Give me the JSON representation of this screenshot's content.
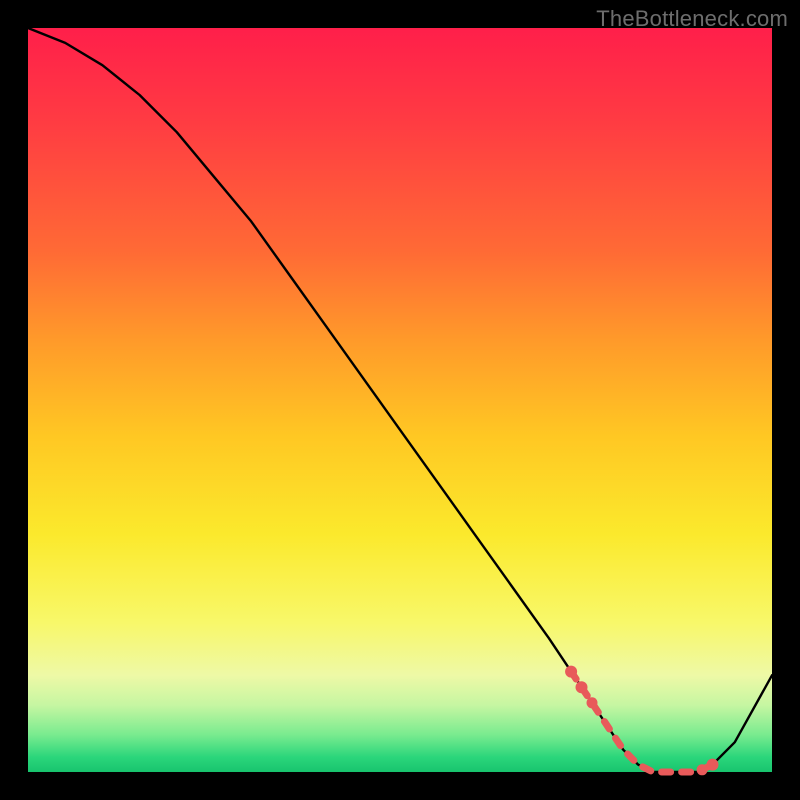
{
  "watermark": "TheBottleneck.com",
  "colors": {
    "background": "#000000",
    "curve": "#000000",
    "highlight": "#e85a5a",
    "gradient_top": "#ff1f4a",
    "gradient_mid": "#fbe92c",
    "gradient_bottom": "#18c46e"
  },
  "chart_data": {
    "type": "line",
    "title": "",
    "xlabel": "",
    "ylabel": "",
    "xlim": [
      0,
      100
    ],
    "ylim": [
      0,
      100
    ],
    "grid": false,
    "legend": false,
    "series": [
      {
        "name": "bottleneck-curve",
        "x": [
          0,
          5,
          10,
          15,
          20,
          25,
          30,
          35,
          40,
          45,
          50,
          55,
          60,
          65,
          70,
          74,
          76,
          78,
          80,
          82,
          84,
          86,
          88,
          90,
          92,
          95,
          100
        ],
        "y": [
          100,
          98,
          95,
          91,
          86,
          80,
          74,
          67,
          60,
          53,
          46,
          39,
          32,
          25,
          18,
          12,
          9,
          6,
          3,
          1,
          0,
          0,
          0,
          0,
          1,
          4,
          13
        ]
      }
    ],
    "highlight_region": {
      "name": "optimal-range",
      "x_start": 73,
      "x_end": 92,
      "note": "flat minimum; dotted segment with large end dots"
    }
  }
}
